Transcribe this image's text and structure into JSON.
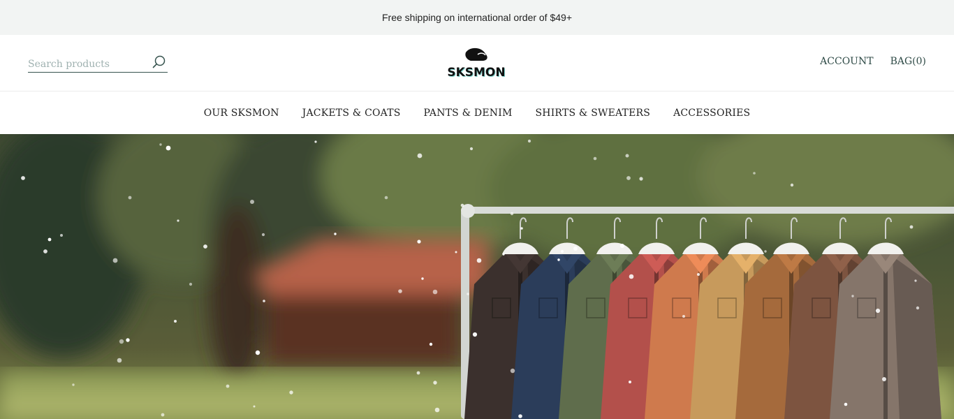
{
  "announcement": {
    "text": "Free shipping on international order of $49+"
  },
  "search": {
    "placeholder": "Search products",
    "value": ""
  },
  "logo": {
    "text": "SKSMON"
  },
  "account": {
    "account_label": "ACCOUNT",
    "bag_label": "BAG(0)"
  },
  "nav": {
    "items": [
      {
        "label": "OUR SKSMON"
      },
      {
        "label": "JACKETS & COATS"
      },
      {
        "label": "PANTS & DENIM"
      },
      {
        "label": "SHIRTS & SWEATERS"
      },
      {
        "label": "ACCESSORIES"
      }
    ]
  },
  "colors": {
    "announcement_bg": "#f2f4f3",
    "accent": "#35524d",
    "jackets": [
      "#3b302d",
      "#2b3d5a",
      "#5f6d4c",
      "#b3504b",
      "#cf7a4d",
      "#c79a5c",
      "#a56a3c",
      "#7d5440",
      "#85756a"
    ]
  }
}
